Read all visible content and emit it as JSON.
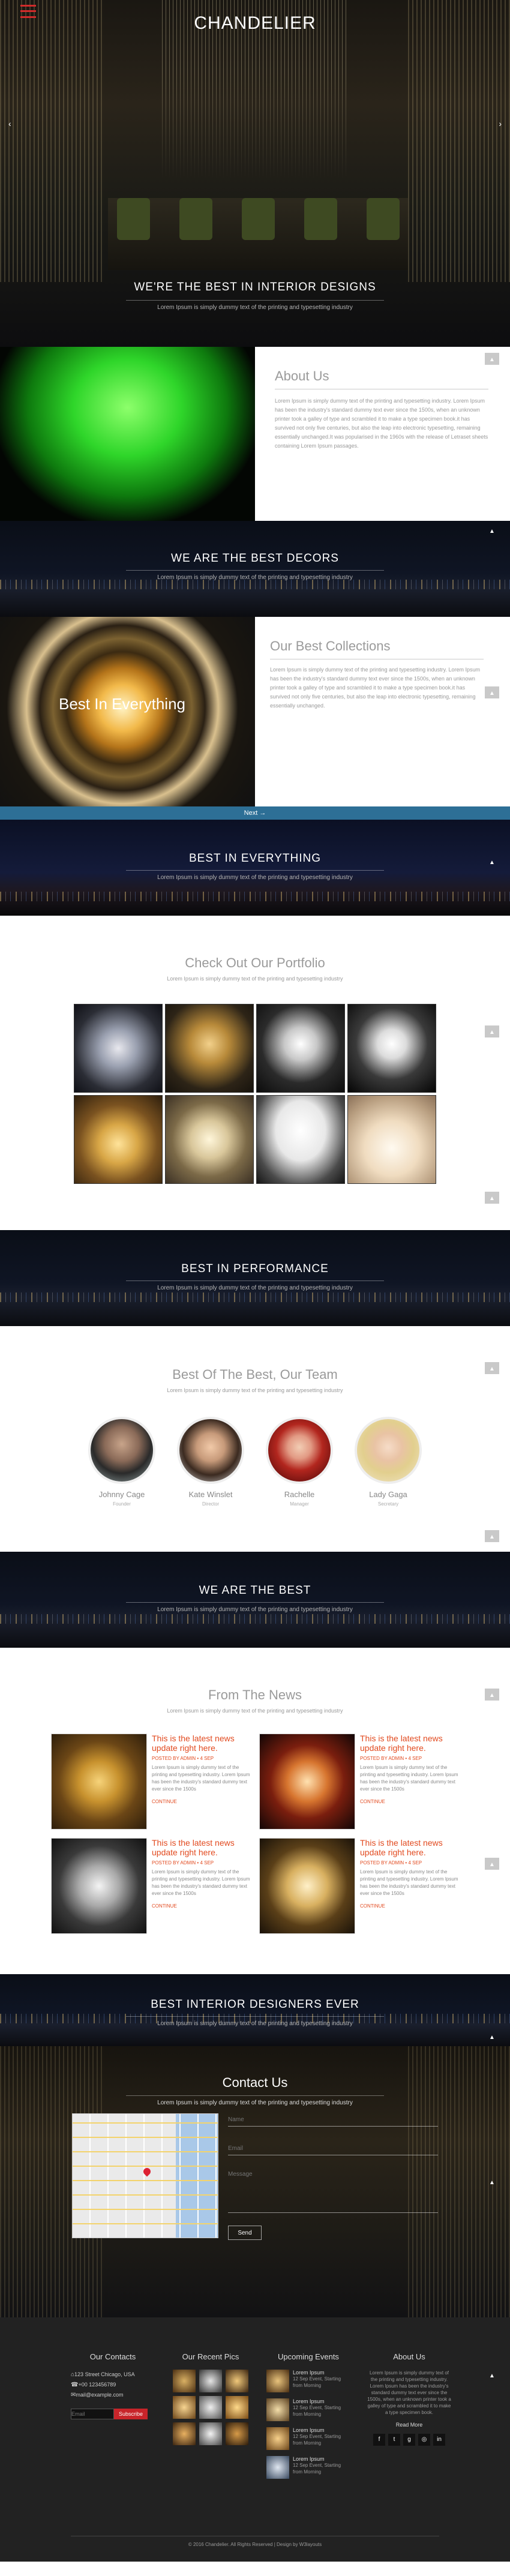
{
  "brand": {
    "logo": "CHANDELIER"
  },
  "hero": {
    "title": "WE'RE THE BEST IN INTERIOR DESIGNS",
    "sub": "Lorem Ipsum is simply dummy text of the printing and typesetting industry"
  },
  "about": {
    "title": "About Us",
    "body": "Lorem Ipsum is simply dummy text of the printing and typesetting industry. Lorem Ipsum has been the industry's standard dummy text ever since the 1500s, when an unknown printer took a galley of type and scrambled it to make a type specimen book.it has survived not only five centuries, but also the leap into electronic typesetting, remaining essentially unchanged.It was popularised in the 1960s with the release of Letraset sheets containing Lorem Ipsum passages."
  },
  "decors": {
    "title": "WE ARE THE BEST DECORS",
    "sub": "Lorem Ipsum is simply dummy text of the printing and typesetting industry"
  },
  "collections": {
    "title": "Our Best Collections",
    "overlay": "Best In Everything",
    "body": "Lorem Ipsum is simply dummy text of the printing and typesetting industry. Lorem Ipsum has been the industry's standard dummy text ever since the 1500s, when an unknown printer took a galley of type and scrambled it to make a type specimen book.it has survived not only five centuries, but also the leap into electronic typesetting, remaining essentially unchanged."
  },
  "nextbar": {
    "label": "Next →"
  },
  "everything": {
    "title": "BEST IN EVERYTHING",
    "sub": "Lorem Ipsum is simply dummy text of the printing and typesetting industry"
  },
  "portfolio": {
    "title": "Check Out Our Portfolio",
    "sub": "Lorem Ipsum is simply dummy text of the printing and typesetting industry"
  },
  "performance": {
    "title": "BEST IN PERFORMANCE",
    "sub": "Lorem Ipsum is simply dummy text of the printing and typesetting industry"
  },
  "team": {
    "title": "Best Of The Best, Our Team",
    "sub": "Lorem Ipsum is simply dummy text of the printing and typesetting industry",
    "members": [
      {
        "name": "Johnny Cage",
        "role": "Founder"
      },
      {
        "name": "Kate Winslet",
        "role": "Director"
      },
      {
        "name": "Rachelle",
        "role": "Manager"
      },
      {
        "name": "Lady Gaga",
        "role": "Secretary"
      }
    ]
  },
  "webest": {
    "title": "WE ARE THE BEST",
    "sub": "Lorem Ipsum is simply dummy text of the printing and typesetting industry"
  },
  "news": {
    "title": "From The News",
    "sub": "Lorem Ipsum is simply dummy text of the printing and typesetting industry",
    "items": [
      {
        "title": "This is the latest news update right here.",
        "meta": "POSTED BY ADMIN • 4 SEP",
        "excerpt": "Lorem Ipsum is simply dummy text of the printing and typesetting industry. Lorem Ipsum has been the industry's standard dummy text ever since the 1500s",
        "more": "CONTINUE"
      },
      {
        "title": "This is the latest news update right here.",
        "meta": "POSTED BY ADMIN • 4 SEP",
        "excerpt": "Lorem Ipsum is simply dummy text of the printing and typesetting industry. Lorem Ipsum has been the industry's standard dummy text ever since the 1500s",
        "more": "CONTINUE"
      },
      {
        "title": "This is the latest news update right here.",
        "meta": "POSTED BY ADMIN • 4 SEP",
        "excerpt": "Lorem Ipsum is simply dummy text of the printing and typesetting industry. Lorem Ipsum has been the industry's standard dummy text ever since the 1500s",
        "more": "CONTINUE"
      },
      {
        "title": "This is the latest news update right here.",
        "meta": "POSTED BY ADMIN • 4 SEP",
        "excerpt": "Lorem Ipsum is simply dummy text of the printing and typesetting industry. Lorem Ipsum has been the industry's standard dummy text ever since the 1500s",
        "more": "CONTINUE"
      }
    ]
  },
  "designers": {
    "title": "BEST INTERIOR DESIGNERS EVER",
    "sub": "Lorem Ipsum is simply dummy text of the printing and typesetting industry"
  },
  "contact": {
    "title": "Contact Us",
    "sub": "Lorem Ipsum is simply dummy text of the printing and typesetting industry",
    "name_ph": "Name",
    "email_ph": "Email",
    "msg_ph": "Message",
    "send": "Send"
  },
  "footer": {
    "contacts_title": "Our Contacts",
    "address": "123 Street Chicago, USA",
    "phone": "+00 123456789",
    "email": "mail@example.com",
    "newsletter_ph": "Email",
    "subscribe": "Subscribe",
    "pics_title": "Our Recent Pics",
    "events_title": "Upcoming Events",
    "events": [
      {
        "t": "Lorem Ipsum",
        "d": "12 Sep Event, Starting from Morning"
      },
      {
        "t": "Lorem Ipsum",
        "d": "12 Sep Event, Starting from Morning"
      },
      {
        "t": "Lorem Ipsum",
        "d": "12 Sep Event, Starting from Morning"
      },
      {
        "t": "Lorem Ipsum",
        "d": "12 Sep Event, Starting from Morning"
      }
    ],
    "about_title": "About Us",
    "about_body": "Lorem Ipsum is simply dummy text of the printing and typesetting industry. Lorem Ipsum has been the industry's standard dummy text ever since the 1500s, when an unknown printer took a galley of type and scrambled it to make a type specimen book.",
    "read_more": "Read More",
    "copyright": "© 2016 Chandelier. All Rights Reserved | Design by W3layouts"
  }
}
